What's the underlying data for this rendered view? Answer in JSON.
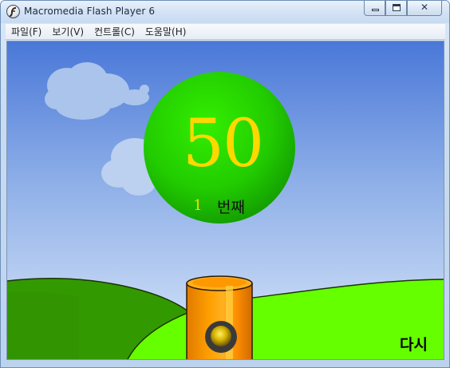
{
  "window": {
    "title": "Macromedia Flash Player 6",
    "controls": {
      "minimize": "minimize",
      "maximize": "maximize",
      "close": "✕"
    }
  },
  "menu": [
    "파일(F)",
    "보기(V)",
    "컨트롤(C)",
    "도움말(H)"
  ],
  "game": {
    "score": "50",
    "turn_number": "1",
    "turn_label": "번째",
    "retry_label": "다시"
  },
  "colors": {
    "sky_top": "#4a78d8",
    "sky_bottom": "#c8dcf6",
    "ball": "#22cc00",
    "score_text": "#ffd800",
    "cannon": "#ff9900",
    "hill_light": "#66ff00",
    "hill_dark": "#339900"
  }
}
